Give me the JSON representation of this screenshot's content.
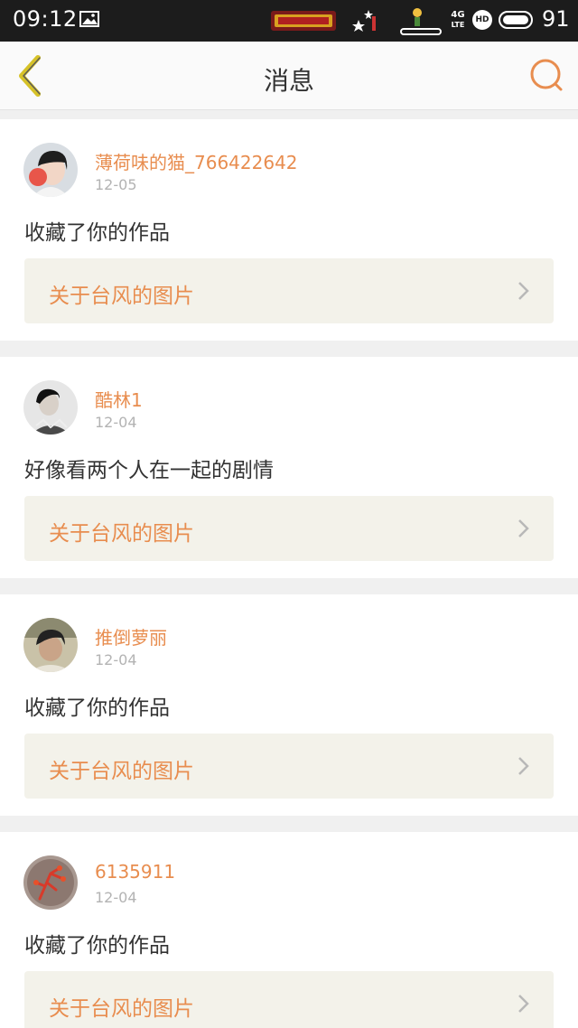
{
  "status_bar": {
    "time": "09:12",
    "network": "4G",
    "network_sub": "LTE",
    "hd": "HD",
    "battery_level": "91"
  },
  "header": {
    "title": "消息",
    "back_icon": "chevron-left-icon",
    "search_icon": "search-icon"
  },
  "colors": {
    "accent": "#e88d4f",
    "back_icon": "#d6c228",
    "card_work_bg": "#f3f2ea"
  },
  "messages": [
    {
      "user": "薄荷味的猫_766422642",
      "date": "12-05",
      "text": "收藏了你的作品",
      "work_title": "关于台风的图片"
    },
    {
      "user": "酷林1",
      "date": "12-04",
      "text": "好像看两个人在一起的剧情",
      "work_title": "关于台风的图片"
    },
    {
      "user": "推倒萝丽",
      "date": "12-04",
      "text": "收藏了你的作品",
      "work_title": "关于台风的图片"
    },
    {
      "user": "6135911",
      "date": "12-04",
      "text": "收藏了你的作品",
      "work_title": "关于台风的图片"
    }
  ]
}
